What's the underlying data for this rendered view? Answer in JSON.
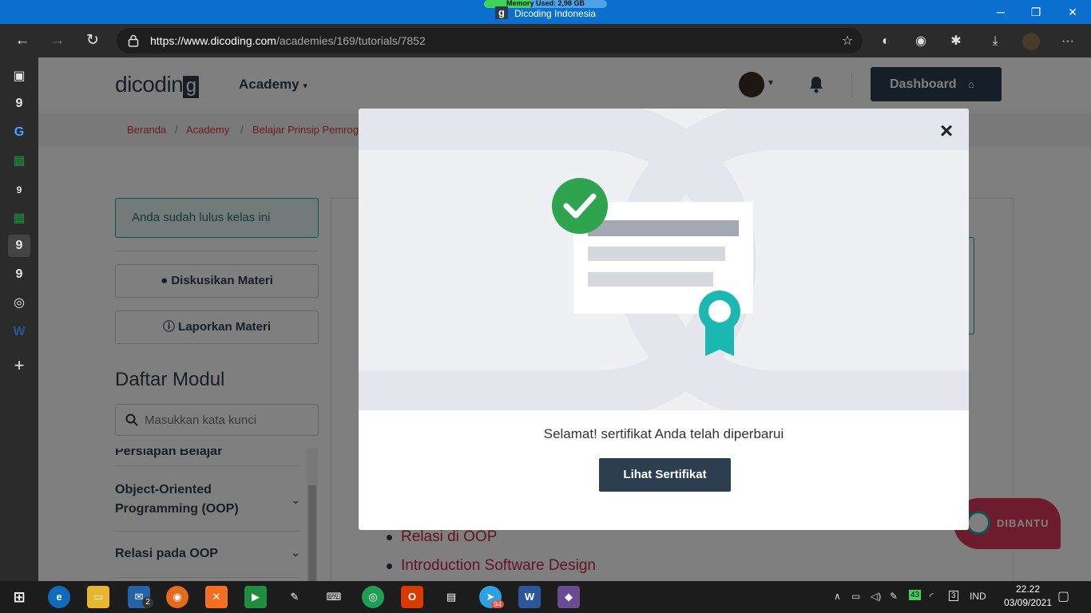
{
  "window": {
    "memory_label": "Memory Used: 2,98 GB",
    "memory_fraction": 0.38,
    "title": "Dicoding Indonesia",
    "minimize": "─",
    "restore": "❐",
    "close": "✕"
  },
  "browser": {
    "url_host": "https://www.dicoding.com",
    "url_path": "/academies/169/tutorials/7852",
    "back": "←",
    "forward": "→",
    "refresh": "↻",
    "menu": "···"
  },
  "vertical_tabs": [
    "9",
    "G",
    "9",
    "9",
    "9"
  ],
  "header": {
    "logo_text": "dicodin",
    "logo_last": "g",
    "academy_label": "Academy",
    "dashboard_label": "Dashboard"
  },
  "breadcrumb": [
    "Beranda",
    "Academy",
    "Belajar Prinsip Pemrog"
  ],
  "sidebar": {
    "passed_label": "Anda sudah lulus kelas ini",
    "discuss_label": "Diskusikan Materi",
    "report_label": "Laporkan Materi",
    "modules_title": "Daftar Modul",
    "search_placeholder": "Masukkan kata kunci",
    "modules": [
      "Persiapan Belajar",
      "Object-Oriented Programming (OOP)",
      "Relasi pada OOP"
    ]
  },
  "content": {
    "list": [
      "Relasi di OOP",
      "Introduction Software Design"
    ]
  },
  "chat_widget": {
    "label": "DIBANTU"
  },
  "modal": {
    "message": "Selamat! sertifikat Anda telah diperbarui",
    "button_label": "Lihat Sertifikat",
    "close_label": "×"
  },
  "taskbar": {
    "mail_badge": "2",
    "telegram_badge": "94",
    "battery_level": "43",
    "notif_count": "3",
    "language": "IND",
    "time": "22.22",
    "date": "03/09/2021"
  },
  "colors": {
    "brand_dark": "#2d3e50",
    "accent_teal": "#1aa6a0",
    "link_red": "#c5284b",
    "check_green": "#2ea44f",
    "titlebar_blue": "#0a6fcf"
  }
}
